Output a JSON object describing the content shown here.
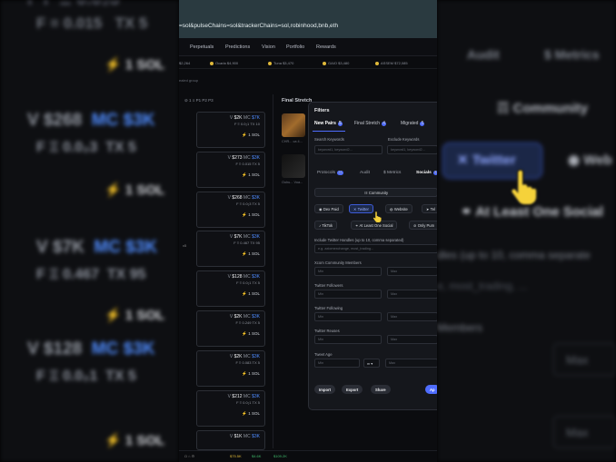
{
  "browser": {
    "url_fragment": "=sol&pulseChains=sol&trackerChains=sol,robinhood,bnb,eth"
  },
  "nav": {
    "items": [
      "Perpetuals",
      "Predictions",
      "Vision",
      "Portfolio",
      "Rewards"
    ]
  },
  "tickers": [
    "$2,264",
    "Ocarla $4,900",
    "Tuna $3,470",
    "GAIO $3,480",
    "ASSEM $72,085"
  ],
  "sub_caption": "ealed group",
  "column_header": {
    "icons": "⊘ 1  ≡  P1  P2  P3",
    "title": "Final Stretch"
  },
  "cards": [
    {
      "v": "$2K",
      "mc": "$7K",
      "f": "0.0₂1",
      "tx": "10",
      "sol": "1 SOL"
    },
    {
      "v": "$273",
      "mc": "$3K",
      "f": "0.015",
      "tx": "5",
      "sol": "1 SOL"
    },
    {
      "v": "$268",
      "mc": "$3K",
      "f": "0.0₂3",
      "tx": "5",
      "sol": "1 SOL"
    },
    {
      "v": "$7K",
      "mc": "$3K",
      "f": "0.467",
      "tx": "95",
      "sol": "1 SOL"
    },
    {
      "v": "$128",
      "mc": "$3K",
      "f": "0.0₂1",
      "tx": "5",
      "sol": "1 SOL"
    },
    {
      "v": "$2K",
      "mc": "$3K",
      "f": "0.249",
      "tx": "5",
      "sol": "1 SOL"
    },
    {
      "v": "$2K",
      "mc": "$3K",
      "f": "0.083",
      "tx": "5",
      "sol": "1 SOL"
    },
    {
      "v": "$212",
      "mc": "$3K",
      "f": "0.0₂1",
      "tx": "5",
      "sol": "1 SOL"
    },
    {
      "v": "$1K",
      "mc": "$3K",
      "f": "",
      "tx": "",
      "sol": ""
    }
  ],
  "row_label": "x5",
  "thumb_captions": [
    "CHR... ca 4...",
    "Oohu... Voa..."
  ],
  "bottom": {
    "left": "Ω ⌂ ⚙",
    "a": "$75.5K",
    "b": "$4.6K",
    "c": "$109.2K"
  },
  "filters": {
    "title": "Filters",
    "tabs": [
      {
        "label": "New Pairs",
        "badge": "5"
      },
      {
        "label": "Final Stretch",
        "badge": "4"
      },
      {
        "label": "Migrated",
        "badge": "5"
      }
    ],
    "search_keywords_label": "Search Keywords",
    "exclude_keywords_label": "Exclude Keywords",
    "keywords_placeholder": "keyword1, keyword2...",
    "subtabs": [
      "Protocols",
      "Audit",
      "$ Metrics",
      "Socials"
    ],
    "subtab_badges": {
      "protocols": "11",
      "socials": "1"
    },
    "community_label": "Community",
    "dex_paid_label": "Dex Paid",
    "twitter_label": "Twitter",
    "website_label": "Website",
    "telegram_label": "Tel",
    "tiktok_label": "TikTok",
    "at_least_one_social_label": "At Least One Social",
    "only_pump_label": "Only Pum",
    "twitter_handles_label": "Include Twitter Handles (up to 10, comma separated)",
    "twitter_handles_placeholder": "e.g. axiomexchange, most_trading...",
    "community_members_label": "Xcom Community Members",
    "twitter_followers_label": "Twitter Followers",
    "twitter_following_label": "Twitter Following",
    "twitter_reuses_label": "Twitter Reuses",
    "tweet_age_label": "Tweet Age",
    "min": "Min",
    "max": "Max",
    "unit": "m",
    "import": "Import",
    "export": "Export",
    "share": "Share",
    "apply": "Ap"
  },
  "bg_left": {
    "rows": [
      {
        "a": "V $268",
        "b": "MC $3K"
      },
      {
        "a": "F Ξ 0.0₂3",
        "b": "TX 5"
      },
      {
        "a": "⚡ 1 SOL"
      },
      {
        "a": "V $7K",
        "b": "MC $3K"
      },
      {
        "a": "F Ξ 0.467",
        "b": "TX 95"
      },
      {
        "a": "⚡ 1 SOL"
      },
      {
        "a": "V $128",
        "b": "MC $3K"
      },
      {
        "a": "F Ξ 0.0₂1",
        "b": "TX 5"
      },
      {
        "a": "⚡ 1 SOL"
      },
      {
        "a": "⚡ 1 SOL"
      },
      {
        "a": "⚡ 1 SOL"
      },
      {
        "a": "⚡ 1 SOL"
      }
    ]
  },
  "bg_right": {
    "audit": "Audit",
    "metrics": "$ Metrics",
    "community": "Community",
    "twitter": "Twitter",
    "web": "Web",
    "at_least_one_social": "At Least One Social",
    "handles_hint": "dles (up to 10, comma separate",
    "handles_example": "e, most_trading, ...",
    "members": "Members",
    "max": "Max"
  }
}
